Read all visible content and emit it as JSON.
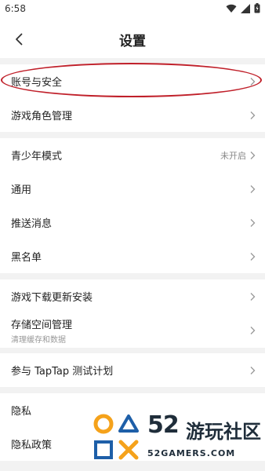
{
  "status_bar": {
    "time": "6:58"
  },
  "header": {
    "title": "设置"
  },
  "groups": [
    {
      "items": [
        {
          "label": "账号与安全"
        },
        {
          "label": "游戏角色管理"
        }
      ]
    },
    {
      "items": [
        {
          "label": "青少年模式",
          "value": "未开启"
        },
        {
          "label": "通用"
        },
        {
          "label": "推送消息"
        },
        {
          "label": "黑名单"
        }
      ]
    },
    {
      "items": [
        {
          "label": "游戏下载更新安装"
        },
        {
          "label": "存储空间管理",
          "sublabel": "清理缓存和数据"
        }
      ]
    },
    {
      "items": [
        {
          "label": "参与 TapTap 测试计划"
        }
      ]
    },
    {
      "items": [
        {
          "label": "隐私"
        },
        {
          "label": "隐私政策"
        }
      ]
    }
  ],
  "watermark": {
    "number": "52",
    "brand": "游玩社区",
    "domain": "52GAMERS.COM"
  },
  "colors": {
    "highlight": "#c0202a",
    "watermark_orange": "#f5a21b",
    "watermark_blue": "#1e5fa8"
  }
}
